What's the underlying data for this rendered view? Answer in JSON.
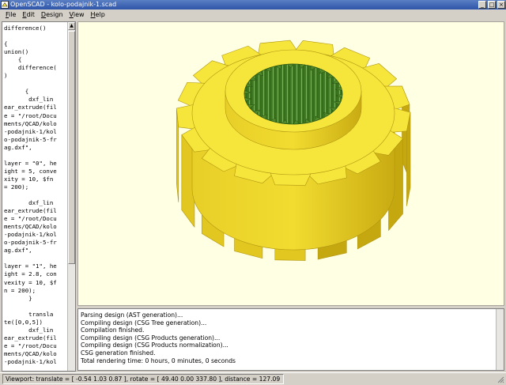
{
  "window": {
    "title": "OpenSCAD - kolo-podajnik-1.scad",
    "minimize_glyph": "_",
    "maximize_glyph": "□",
    "close_glyph": "×"
  },
  "menu": {
    "items": [
      {
        "label": "File"
      },
      {
        "label": "Edit"
      },
      {
        "label": "Design"
      },
      {
        "label": "View"
      },
      {
        "label": "Help"
      }
    ]
  },
  "editor": {
    "code": "difference()\n\n{\nunion()\n    {\n    difference(\n)\n\n      {\n       dxf_lin\near_extrude(fil\ne = \"/root/Docu\nments/QCAD/kolo\n-podajnik-1/kol\no-podajnik-5-fr\nag.dxf\",\n\nlayer = \"0\", he\night = 5, conve\nxity = 10, $fn\n= 200);\n\n       dxf_lin\near_extrude(fil\ne = \"/root/Docu\nments/QCAD/kolo\n-podajnik-1/kol\no-podajnik-5-fr\nag.dxf\",\n\nlayer = \"1\", he\night = 2.8, con\nvexity = 10, $f\nn = 200);\n       }\n\n       transla\nte([0,0,5])\n       dxf_lin\near_extrude(fil\ne = \"/root/Docu\nments/QCAD/kolo\n-podajnik-1/kol",
    "scroll_up_glyph": "▲"
  },
  "console": {
    "lines": [
      "Parsing design (AST generation)...",
      "Compiling design (CSG Tree generation)...",
      "Compilation finished.",
      "Compiling design (CSG Products generation)...",
      "Compiling design (CSG Products normalization)...",
      "CSG generation finished.",
      "Total rendering time: 0 hours, 0 minutes, 0 seconds"
    ]
  },
  "statusbar": {
    "text": "Viewport: translate = [ -0.54 1.03 0.87 ], rotate = [ 49.40 0.00 337.80 ], distance = 127.09"
  },
  "colors": {
    "viewport_bg": "#ffffe4",
    "gear_face": "#f6e63c",
    "gear_side": "#e2c720",
    "gear_side_dark": "#c5a810",
    "hole_green": "#3f7a22",
    "title_bar": "#2e54a8"
  },
  "icons": {
    "app": "openscad-app-icon",
    "resize": "resize-grip-icon"
  }
}
